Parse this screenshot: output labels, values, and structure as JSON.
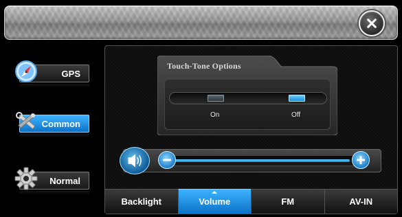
{
  "header": {
    "close_icon": "close-circle-icon"
  },
  "nav": {
    "items": [
      {
        "label": "GPS",
        "icon": "compass-icon",
        "active": false
      },
      {
        "label": "Common",
        "icon": "tools-icon",
        "active": true
      },
      {
        "label": "Normal",
        "icon": "gear-icon",
        "active": false
      }
    ]
  },
  "touch_tone": {
    "title": "Touch-Tone Options",
    "on_label": "On",
    "off_label": "Off",
    "selected": "Off"
  },
  "volume": {
    "level": 0.95,
    "icon": "speaker-icon"
  },
  "tabs": [
    {
      "label": "Backlight",
      "active": false
    },
    {
      "label": "Volume",
      "active": true
    },
    {
      "label": "FM",
      "active": false
    },
    {
      "label": "AV-IN",
      "active": false
    }
  ],
  "colors": {
    "accent": "#1d8fdc",
    "accent_light": "#63d1ff"
  }
}
